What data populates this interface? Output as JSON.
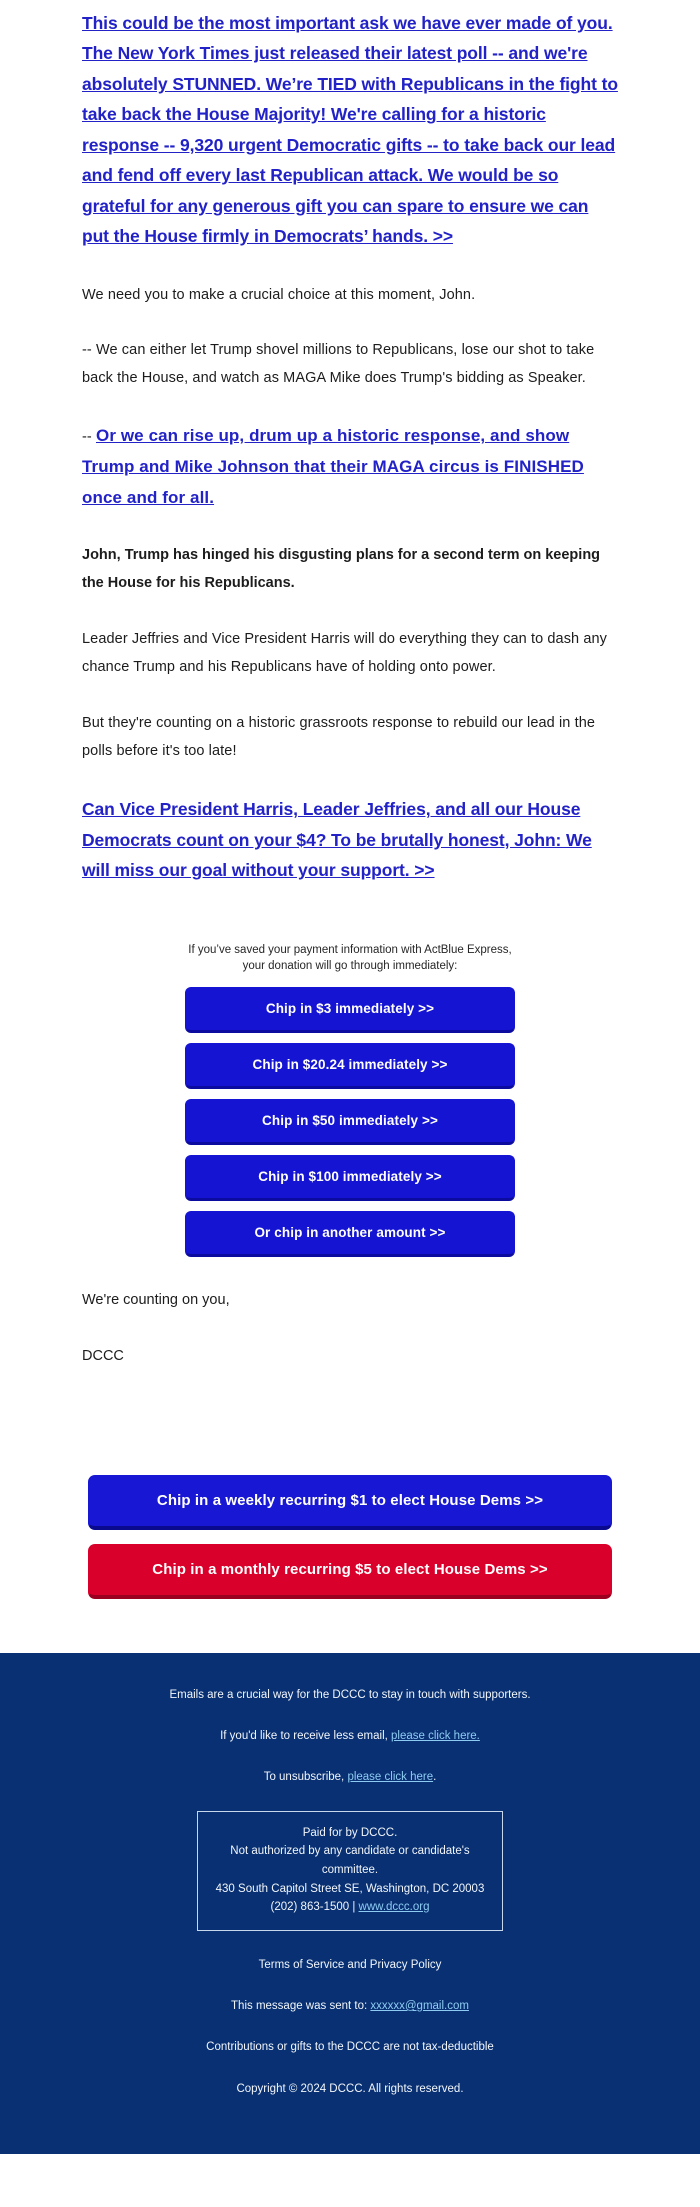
{
  "colors": {
    "link_blue": "#2222C7",
    "button_blue": "#1414D2",
    "recurring_blue": "#1717D4",
    "recurring_red": "#D9002B",
    "footer_navy": "#083072",
    "footer_link": "#8ECBF2",
    "body_text": "#1C1C1C"
  },
  "message": {
    "hero_link": "This could be the most important ask we have ever made of you. The New York Times just released their latest poll -- and we're absolutely STUNNED. We’re TIED with Republicans in the fight to take back the House Majority! We're calling for a historic response -- 9,320 urgent Democratic gifts -- to take back our lead and fend off every last Republican attack. We would be so grateful for any generous gift you can spare to ensure we can put the House firmly in Democrats’ hands. >>",
    "para_1": "We need you to make a crucial choice at this moment, John.",
    "para_2": "-- We can either let Trump shovel millions to Republicans, lose our shot to take back the House, and watch as MAGA Mike does Trump's bidding as Speaker.",
    "para_3_dash": "-- ",
    "para_3_link": "Or we can rise up, drum up a historic response, and show Trump and Mike Johnson that their MAGA circus is FINISHED once and for all.",
    "para_4_bold": "John, Trump has hinged his disgusting plans for a second term on keeping the House for his Republicans.",
    "para_5": "Leader Jeffries and Vice President Harris will do everything they can to dash any chance Trump and his Republicans have of holding onto power.",
    "para_6": "But they're counting on a historic grassroots response to rebuild our lead in the polls before it's too late!",
    "cta_link": "Can Vice President Harris, Leader Jeffries, and all our House Democrats count on your $4? To be brutally honest, John: We will miss our goal without your support. >>",
    "signoff_line_1": "We're counting on you,",
    "signoff_line_2": "DCCC"
  },
  "express": {
    "note_line_1": "If you’ve saved your payment information with ActBlue Express,",
    "note_line_2": "your donation will go through immediately:",
    "buttons": [
      {
        "label": "Chip in $3 immediately >>"
      },
      {
        "label": "Chip in $20.24 immediately >>"
      },
      {
        "label": "Chip in $50 immediately >>"
      },
      {
        "label": "Chip in $100 immediately >>"
      },
      {
        "label": "Or chip in another amount >>"
      }
    ]
  },
  "recurring": {
    "weekly_label": "Chip in a weekly recurring $1 to elect House Dems >>",
    "monthly_label": "Chip in a monthly recurring $5 to elect House Dems >>"
  },
  "footer": {
    "line_supporters": "Emails are a crucial way for the DCCC to stay in touch with supporters.",
    "less_email_prefix": "If you'd like to receive less email, ",
    "less_email_link": "please click here.",
    "unsubscribe_prefix": "To unsubscribe, ",
    "unsubscribe_link": "please click here",
    "unsubscribe_suffix": ".",
    "paid_line_1": "Paid for by DCCC.",
    "paid_line_2": "Not authorized by any candidate or candidate's committee.",
    "paid_line_3": "430 South Capitol Street SE, Washington, DC 20003",
    "paid_phone": "(202) 863-1500 | ",
    "paid_website": "www.dccc.org",
    "terms": "Terms of Service and Privacy Policy",
    "sent_to_prefix": "This message was sent to: ",
    "sent_to_email": "xxxxxx@gmail.com",
    "tax": "Contributions or gifts to the DCCC are not tax-deductible",
    "copyright": "Copyright © 2024 DCCC. All rights reserved."
  }
}
